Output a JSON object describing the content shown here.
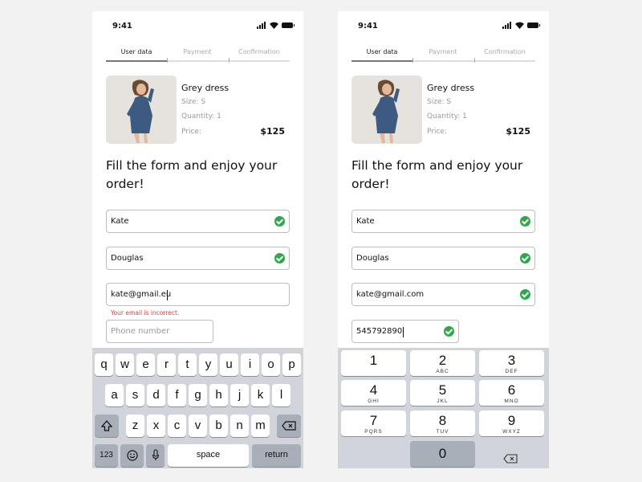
{
  "status_bar": {
    "time": "9:41"
  },
  "stepper": {
    "steps": [
      "User data",
      "Payment",
      "Confirmation"
    ],
    "active_index": 0
  },
  "product": {
    "name": "Grey dress",
    "size": "Size: S",
    "quantity": "Quantity: 1",
    "price_label": "Price:",
    "price": "$125"
  },
  "headline": "Fill the form and enjoy your order!",
  "left_form": {
    "first_name": "Kate",
    "last_name": "Douglas",
    "email": "kate@gmail.eu",
    "email_error": "Your email is incorrect.",
    "phone_placeholder": "Phone number",
    "phone": ""
  },
  "right_form": {
    "first_name": "Kate",
    "last_name": "Douglas",
    "email": "kate@gmail.com",
    "phone": "545792890"
  },
  "keyboard": {
    "row1": [
      "q",
      "w",
      "e",
      "r",
      "t",
      "y",
      "u",
      "i",
      "o",
      "p"
    ],
    "row2": [
      "a",
      "s",
      "d",
      "f",
      "g",
      "h",
      "j",
      "k",
      "l"
    ],
    "row3": [
      "z",
      "x",
      "c",
      "v",
      "b",
      "n",
      "m"
    ],
    "numbers_label": "123",
    "space_label": "space",
    "return_label": "return",
    "icons": {
      "shift": "shift-icon",
      "backspace": "backspace-icon",
      "emoji": "emoji-icon",
      "mic": "microphone-icon"
    }
  },
  "numpad": {
    "keys": [
      {
        "n": "1",
        "s": ""
      },
      {
        "n": "2",
        "s": "ABC"
      },
      {
        "n": "3",
        "s": "DEF"
      },
      {
        "n": "4",
        "s": "GHI"
      },
      {
        "n": "5",
        "s": "JKL"
      },
      {
        "n": "6",
        "s": "MNO"
      },
      {
        "n": "7",
        "s": "PQRS"
      },
      {
        "n": "8",
        "s": "TUV"
      },
      {
        "n": "9",
        "s": "WXYZ"
      }
    ],
    "zero": "0"
  },
  "colors": {
    "valid": "#2ea84a",
    "error": "#e53935",
    "keyboard_bg": "#d1d4da",
    "page_bg": "#f2f2f3"
  }
}
